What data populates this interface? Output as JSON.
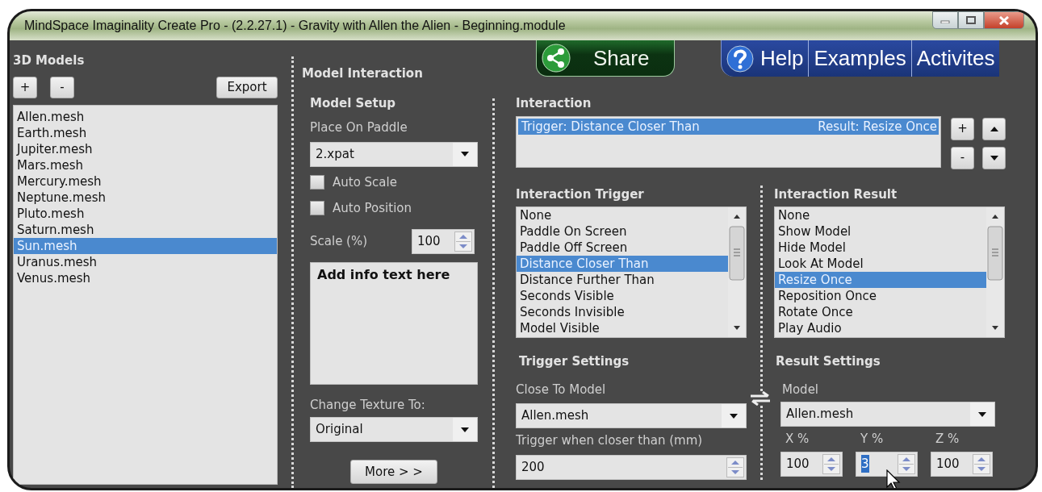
{
  "window": {
    "title": "MindSpace Imaginality Create Pro - (2.2.27.1) - Gravity with Allen the Alien - Beginning.module"
  },
  "top_links": [
    {
      "kind": "share",
      "label": "Share"
    },
    {
      "kind": "help",
      "label": "Help"
    },
    {
      "kind": "plain",
      "label": "Examples"
    },
    {
      "kind": "plain",
      "label": "Activites"
    }
  ],
  "models_panel": {
    "title": "3D Models",
    "add": "+",
    "remove": "-",
    "export": "Export",
    "items": [
      {
        "label": "Allen.mesh",
        "selected": false
      },
      {
        "label": "Earth.mesh",
        "selected": false
      },
      {
        "label": "Jupiter.mesh",
        "selected": false
      },
      {
        "label": "Mars.mesh",
        "selected": false
      },
      {
        "label": "Mercury.mesh",
        "selected": false
      },
      {
        "label": "Neptune.mesh",
        "selected": false
      },
      {
        "label": "Pluto.mesh",
        "selected": false
      },
      {
        "label": "Saturn.mesh",
        "selected": false
      },
      {
        "label": "Sun.mesh",
        "selected": true
      },
      {
        "label": "Uranus.mesh",
        "selected": false
      },
      {
        "label": "Venus.mesh",
        "selected": false
      }
    ]
  },
  "model_interaction": {
    "title": "Model Interaction",
    "setup_title": "Model Setup",
    "paddle_label": "Place On Paddle",
    "paddle_value": "2.xpat",
    "checkboxes": [
      {
        "label": "Auto Scale",
        "checked": false
      },
      {
        "label": "Auto Position",
        "checked": false
      }
    ],
    "scale_label": "Scale (%)",
    "scale_value": "100",
    "info_text": "Add info text here",
    "texture_label": "Change Texture To:",
    "texture_value": "Original",
    "more": "More > >"
  },
  "interaction": {
    "title": "Interaction",
    "rows": [
      {
        "trigger": "Trigger: Distance Closer Than",
        "result": "Result: Resize Once",
        "selected": true
      }
    ],
    "add": "+",
    "remove": "-"
  },
  "trigger": {
    "title": "Interaction Trigger",
    "items": [
      {
        "label": "None",
        "selected": false
      },
      {
        "label": "Paddle On Screen",
        "selected": false
      },
      {
        "label": "Paddle Off Screen",
        "selected": false
      },
      {
        "label": "Distance Closer Than",
        "selected": true
      },
      {
        "label": "Distance Further Than",
        "selected": false
      },
      {
        "label": "Seconds Visible",
        "selected": false
      },
      {
        "label": "Seconds Invisible",
        "selected": false
      },
      {
        "label": "Model Visible",
        "selected": false
      }
    ]
  },
  "result": {
    "title": "Interaction Result",
    "items": [
      {
        "label": "None",
        "selected": false
      },
      {
        "label": "Show Model",
        "selected": false
      },
      {
        "label": "Hide Model",
        "selected": false
      },
      {
        "label": "Look At Model",
        "selected": false
      },
      {
        "label": "Resize Once",
        "selected": true
      },
      {
        "label": "Reposition Once",
        "selected": false
      },
      {
        "label": "Rotate Once",
        "selected": false
      },
      {
        "label": "Play Audio",
        "selected": false
      }
    ]
  },
  "trigger_settings": {
    "title": "Trigger Settings",
    "model_label": "Close To Model",
    "model_value": "Allen.mesh",
    "distance_label": "Trigger when closer than (mm)",
    "distance_value": "200"
  },
  "result_settings": {
    "title": "Result Settings",
    "model_label": "Model",
    "model_value": "Allen.mesh",
    "axes": [
      {
        "label": "X %",
        "value": "100",
        "selected": false
      },
      {
        "label": "Y %",
        "value": "3",
        "selected": true
      },
      {
        "label": "Z %",
        "value": "100",
        "selected": false
      }
    ]
  }
}
